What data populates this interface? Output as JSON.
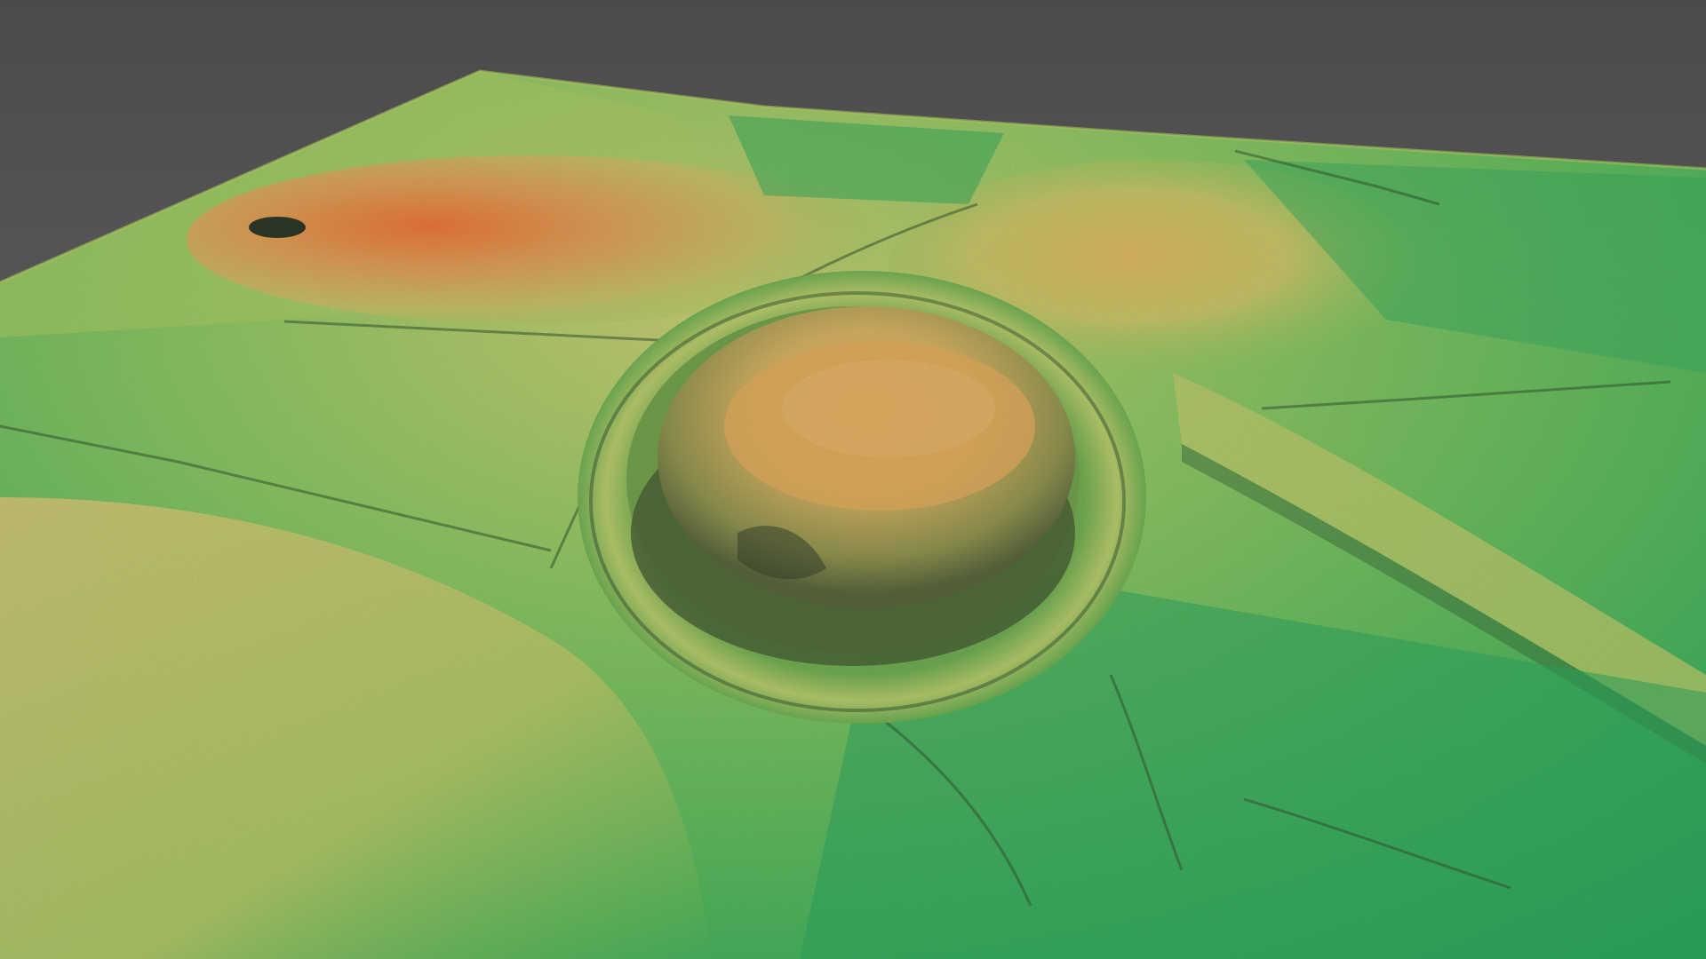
{
  "scene": {
    "background_color": "#5a5a5a",
    "colors": {
      "low": "#1f9a55",
      "mid_low": "#59b24e",
      "mid": "#a9c85a",
      "mid_high": "#d6c06a",
      "high": "#e2924f",
      "peak": "#ec6e36",
      "shadow": "#2f4a2a"
    }
  }
}
